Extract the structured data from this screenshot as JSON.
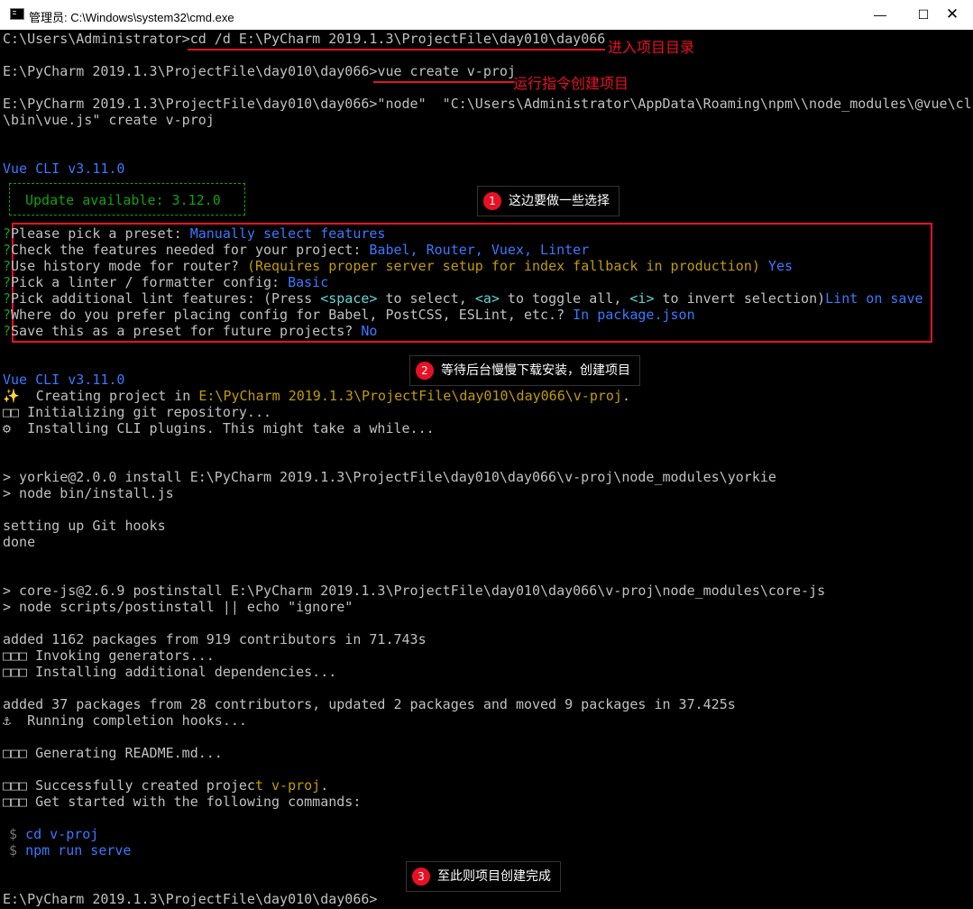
{
  "window": {
    "title": "管理员: C:\\Windows\\system32\\cmd.exe",
    "minimize_glyph": "—",
    "maximize_glyph": "☐",
    "close_glyph": "✕"
  },
  "terminal": {
    "l1": {
      "prompt": "C:\\Users\\Administrator>",
      "cmd": "cd /d E:\\PyCharm 2019.1.3\\ProjectFile\\day010\\day066"
    },
    "l2": {
      "prompt": "E:\\PyCharm 2019.1.3\\ProjectFile\\day010\\day066>",
      "cmd": "vue create v-proj"
    },
    "l3": "E:\\PyCharm 2019.1.3\\ProjectFile\\day010\\day066>\"node\"  \"C:\\Users\\Administrator\\AppData\\Roaming\\npm\\\\node_modules\\@vue\\cli",
    "l4": "\\bin\\vue.js\" create v-proj",
    "vue_cli_1": "Vue CLI v3.11.0",
    "update_available": "Update available: 3.12.0",
    "prompts": [
      {
        "q": "Please pick a preset: ",
        "a": "Manually select features"
      },
      {
        "q": "Check the features needed for your project: ",
        "a": "Babel, Router, Vuex, Linter"
      },
      {
        "q": "Use history mode for router? ",
        "hint": "(Requires proper server setup for index fallback in production)",
        "a": " Yes"
      },
      {
        "q": "Pick a linter / formatter config: ",
        "a": "Basic"
      },
      {
        "q": "Pick additional lint features: ",
        "hint_pre": "(Press ",
        "k1": "<space>",
        "h1": " to select, ",
        "k2": "<a>",
        "h2": " to toggle all, ",
        "k3": "<i>",
        "h3": " to invert selection)",
        "a": "Lint on save"
      },
      {
        "q": "Where do you prefer placing config for Babel, PostCSS, ESLint, etc.? ",
        "a": "In package.json"
      },
      {
        "q": "Save this as a preset for future projects? ",
        "a": "No"
      }
    ],
    "prompt_mark": "?",
    "vue_cli_2": "Vue CLI v3.11.0",
    "creating_pre": "✨  Creating project in ",
    "creating_path": "E:\\PyCharm 2019.1.3\\ProjectFile\\day010\\day066\\v-proj",
    "creating_dot": ".",
    "init_git": "□□ Initializing git repository...",
    "install_plugins": "⚙  Installing CLI plugins. This might take a while...",
    "yorkie1": "> yorkie@2.0.0 install E:\\PyCharm 2019.1.3\\ProjectFile\\day010\\day066\\v-proj\\node_modules\\yorkie",
    "yorkie2": "> node bin/install.js",
    "git_hooks": "setting up Git hooks",
    "done": "done",
    "corejs1": "> core-js@2.6.9 postinstall E:\\PyCharm 2019.1.3\\ProjectFile\\day010\\day066\\v-proj\\node_modules\\core-js",
    "corejs2": "> node scripts/postinstall || echo \"ignore\"",
    "added1": "added 1162 packages from 919 contributors in 71.743s",
    "invoking": "□□□ Invoking generators...",
    "install_deps": "□□□ Installing additional dependencies...",
    "added2": "added 37 packages from 28 contributors, updated 2 packages and moved 9 packages in 37.425s",
    "completion": "⚓  Running completion hooks...",
    "readme": "□□□ Generating README.md...",
    "success_pre": "□□□ Successfully created projec",
    "success_t": "t ",
    "success_proj": "v-proj",
    "success_dot": ".",
    "get_started": "□□□ Get started with the following commands:",
    "dollar": "$",
    "cmd_cd": "cd v-proj",
    "cmd_serve": "npm run serve",
    "final_prompt": "E:\\PyCharm 2019.1.3\\ProjectFile\\day010\\day066>"
  },
  "annotations": {
    "enter_dir": "进入项目目录",
    "run_cmd": "运行指令创建项目",
    "c1_num": "1",
    "c1_text": "这边要做一些选择",
    "c2_num": "2",
    "c2_text": "等待后台慢慢下载安装，创建项目",
    "c3_num": "3",
    "c3_text": "至此则项目创建完成"
  },
  "colors": {
    "annotation_red": "#e81123",
    "cli_blue": "#3b78ff",
    "success_green": "#13a10e",
    "path_yellow": "#c19c00",
    "terminal_text": "#c0c0c0"
  }
}
